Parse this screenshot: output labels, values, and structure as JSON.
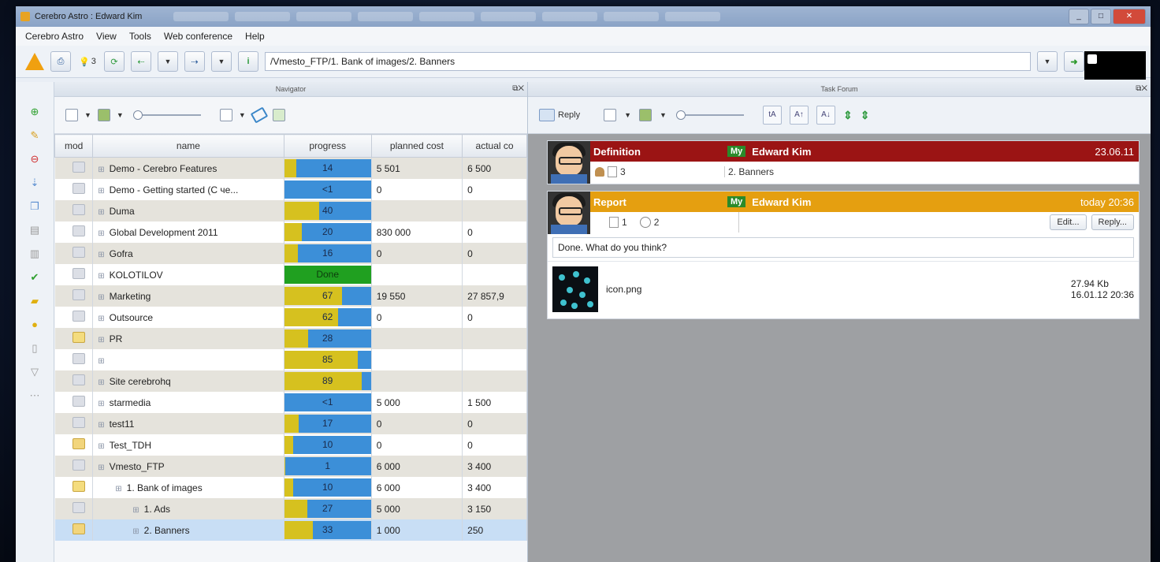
{
  "window": {
    "title": "Cerebro Astro : Edward Kim"
  },
  "menu": [
    "Cerebro Astro",
    "View",
    "Tools",
    "Web conference",
    "Help"
  ],
  "toolbar": {
    "warning_count": "3",
    "path": "/Vmesto_FTP/1. Bank of images/2. Banners"
  },
  "navigator": {
    "title": "Navigator",
    "columns": {
      "mod": "mod",
      "name": "name",
      "progress": "progress",
      "planned_cost": "planned cost",
      "actual_cost": "actual co"
    },
    "rows": [
      {
        "name": "Demo - Cerebro Features",
        "progress": 14,
        "progress_label": "14",
        "planned": "5 501",
        "actual": "6 500",
        "icon": "doc-icon"
      },
      {
        "name": "Demo - Getting started (C че...",
        "progress": 0,
        "progress_label": "<1",
        "planned": "0",
        "actual": "0",
        "icon": "doc-icon"
      },
      {
        "name": "Duma",
        "progress": 40,
        "progress_label": "40",
        "planned": "",
        "actual": "",
        "icon": "doc-icon"
      },
      {
        "name": "Global Development 2011",
        "progress": 20,
        "progress_label": "20",
        "planned": "830 000",
        "actual": "0",
        "icon": "doc-icon"
      },
      {
        "name": "Gofra",
        "progress": 16,
        "progress_label": "16",
        "planned": "0",
        "actual": "0",
        "icon": "doc-icon"
      },
      {
        "name": "KOLOTILOV",
        "progress": 100,
        "progress_label": "Done",
        "planned": "",
        "actual": "",
        "icon": "doc-icon",
        "done": true
      },
      {
        "name": "Marketing",
        "progress": 67,
        "progress_label": "67",
        "planned": "19 550",
        "actual": "27 857,9",
        "icon": "doc-icon"
      },
      {
        "name": "Outsource",
        "progress": 62,
        "progress_label": "62",
        "planned": "0",
        "actual": "0",
        "icon": "doc-icon"
      },
      {
        "name": "PR",
        "progress": 28,
        "progress_label": "28",
        "planned": "",
        "actual": "",
        "icon": "folder-icon"
      },
      {
        "name": "",
        "progress": 85,
        "progress_label": "85",
        "planned": "",
        "actual": "",
        "icon": "doc-icon"
      },
      {
        "name": "Site cerebrohq",
        "progress": 89,
        "progress_label": "89",
        "planned": "",
        "actual": "",
        "icon": "doc-icon"
      },
      {
        "name": "starmedia",
        "progress": 0,
        "progress_label": "<1",
        "planned": "5 000",
        "actual": "1 500",
        "icon": "doc-icon"
      },
      {
        "name": "test11",
        "progress": 17,
        "progress_label": "17",
        "planned": "0",
        "actual": "0",
        "icon": "doc-icon"
      },
      {
        "name": "Test_TDH",
        "progress": 10,
        "progress_label": "10",
        "planned": "0",
        "actual": "0",
        "icon": "pen-icon"
      },
      {
        "name": "Vmesto_FTP",
        "progress": 1,
        "progress_label": "1",
        "planned": "6 000",
        "actual": "3 400",
        "icon": "doc-icon"
      },
      {
        "name": "1. Bank of images",
        "progress": 10,
        "progress_label": "10",
        "planned": "6 000",
        "actual": "3 400",
        "icon": "folder-icon",
        "indent": 1
      },
      {
        "name": "1. Ads",
        "progress": 27,
        "progress_label": "27",
        "planned": "5 000",
        "actual": "3 150",
        "icon": "doc-icon",
        "indent": 2
      },
      {
        "name": "2. Banners",
        "progress": 33,
        "progress_label": "33",
        "planned": "1 000",
        "actual": "250",
        "icon": "pen-icon",
        "indent": 2,
        "selected": true
      }
    ]
  },
  "forum": {
    "title": "Task Forum",
    "reply_label": "Reply",
    "definition": {
      "type": "Definition",
      "my": "My",
      "author": "Edward Kim",
      "date": "23.06.11",
      "count": "3",
      "task": "2. Banners"
    },
    "report": {
      "type": "Report",
      "my": "My",
      "author": "Edward Kim",
      "date": "today 20:36",
      "pages": "1",
      "comments": "2",
      "edit_label": "Edit...",
      "reply_label": "Reply...",
      "body": "Done. What do you think?",
      "attachment": {
        "name": "icon.png",
        "size": "27.94 Kb",
        "date": "16.01.12 20:36"
      }
    }
  },
  "colors": {
    "progress_blue": "#3c8fd8",
    "progress_yellow": "#d6c11f",
    "done_green": "#20a020",
    "definition_red": "#9b1414",
    "report_orange": "#e59f10"
  }
}
